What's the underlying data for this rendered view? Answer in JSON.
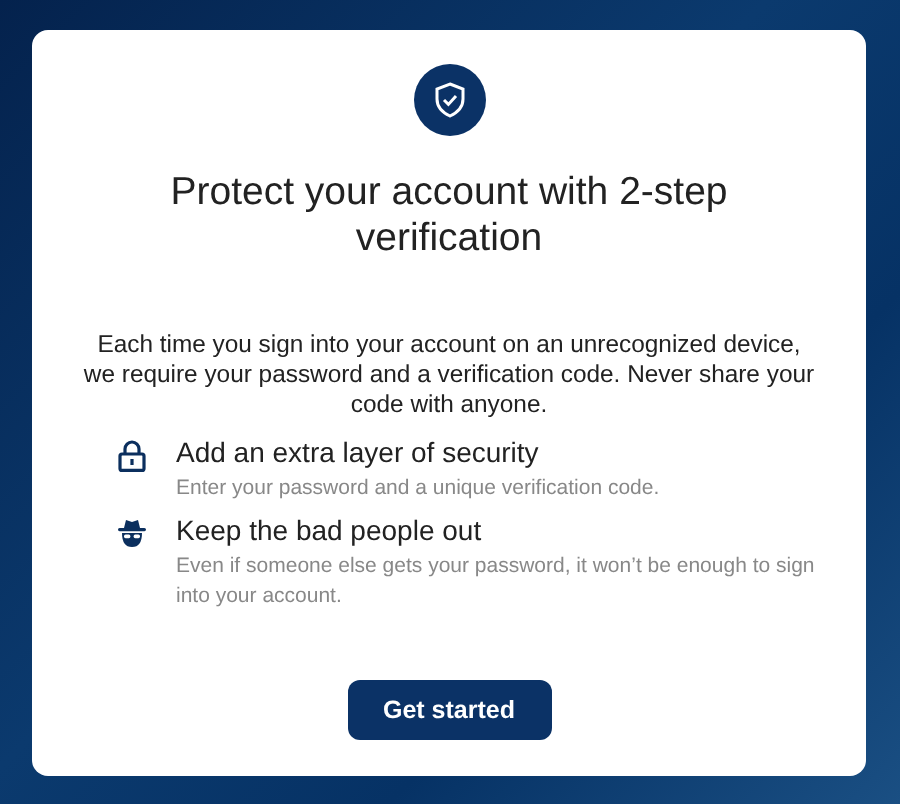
{
  "card": {
    "title": "Protect your account with 2-step verification",
    "description": "Each time you sign into your account on an unrecognized device, we require your password and a verification code. Never share your code with anyone.",
    "features": [
      {
        "kind": "lock",
        "title": "Add an extra layer of security",
        "detail": "Enter your password and a unique verification code."
      },
      {
        "kind": "agent",
        "title": "Keep the bad people out",
        "detail": "Even if someone else gets your password, it won’t be enough to sign into your account."
      }
    ],
    "button": "Get started"
  }
}
